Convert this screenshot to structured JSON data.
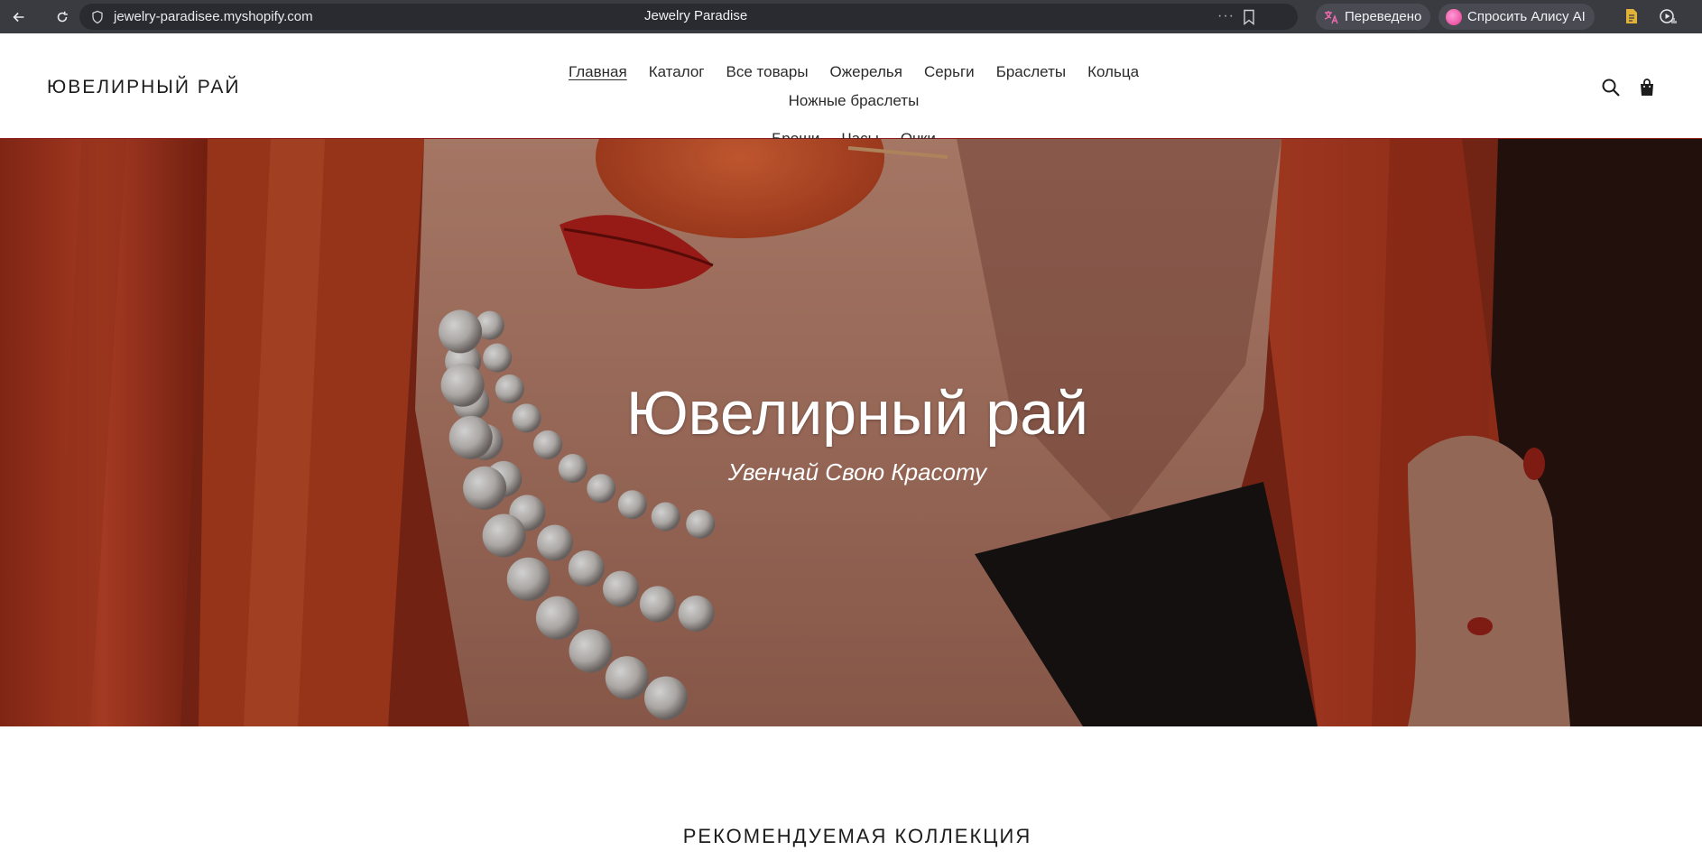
{
  "browser": {
    "url": "jewelry-paradisee.myshopify.com",
    "tab_title": "Jewelry Paradise",
    "more_label": "···",
    "translated_label": "Переведено",
    "alice_label": "Спросить Алису AI",
    "icons": [
      "back-icon",
      "reload-icon",
      "shield-icon",
      "more-icon",
      "bookmark-icon",
      "translate-icon",
      "alice-icon",
      "notes-icon",
      "play-icon"
    ]
  },
  "header": {
    "logo": "ЮВЕЛИРНЫЙ РАЙ",
    "nav": [
      {
        "label": "Главная",
        "active": true
      },
      {
        "label": "Каталог"
      },
      {
        "label": "Все товары"
      },
      {
        "label": "Ожерелья"
      },
      {
        "label": "Серьги"
      },
      {
        "label": "Браслеты"
      },
      {
        "label": "Кольца"
      },
      {
        "label": "Ножные браслеты"
      },
      {
        "label": "Броши"
      },
      {
        "label": "Часы"
      },
      {
        "label": "Очки"
      }
    ],
    "icons": [
      "search-icon",
      "cart-icon"
    ]
  },
  "hero": {
    "title": "Ювелирный рай",
    "subtitle": "Увенчай Свою Красоту"
  },
  "featured": {
    "title": "РЕКОМЕНДУЕМАЯ КОЛЛЕКЦИЯ"
  },
  "colors": {
    "chrome_bg": "#3a3b40",
    "url_bg": "#2a2b30",
    "hero_red": "#b5391f",
    "text_dark": "#1c1c1c"
  }
}
